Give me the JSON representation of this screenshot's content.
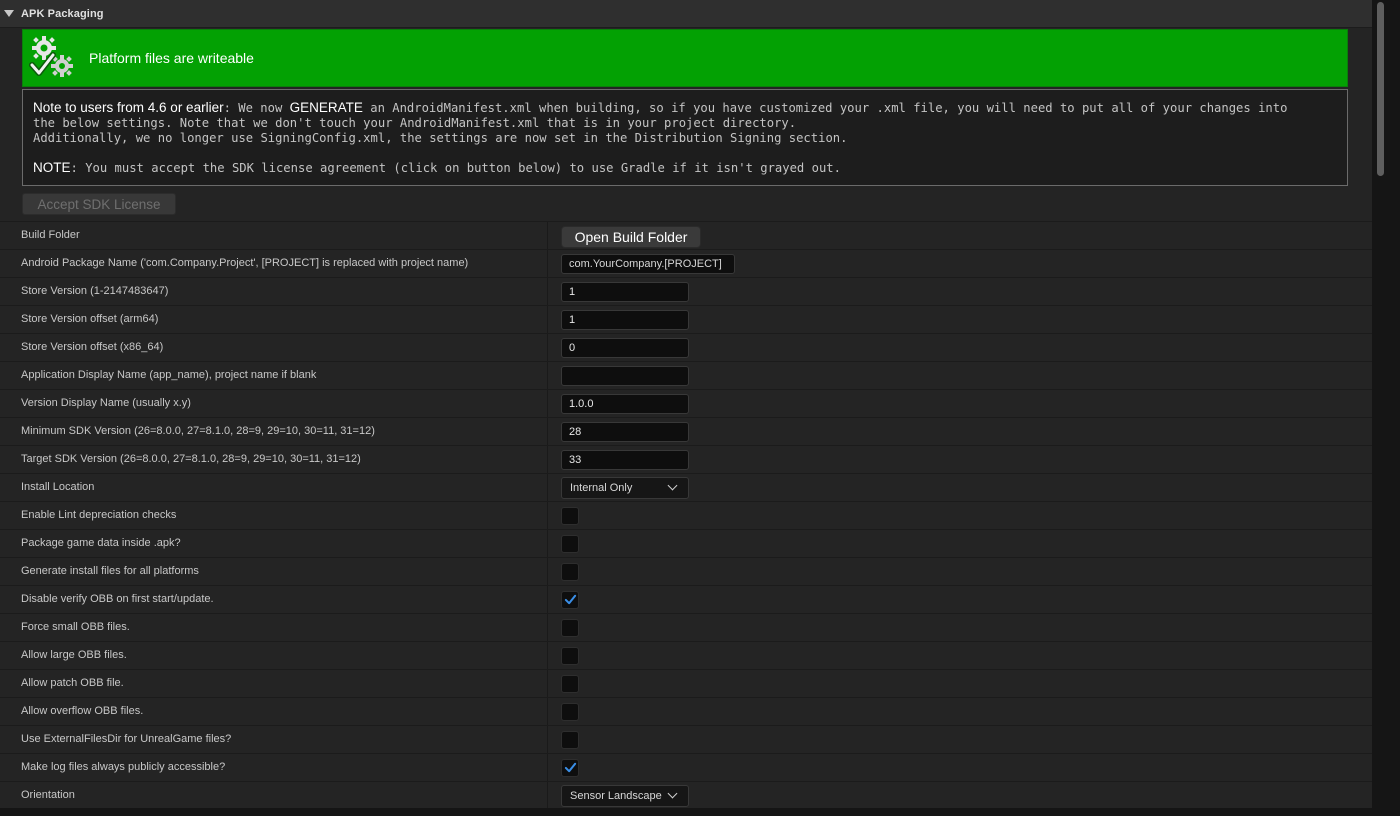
{
  "section": {
    "title": "APK Packaging"
  },
  "banner": {
    "text": "Platform files are writeable",
    "icon": "gears-check-icon",
    "color": "#03a103"
  },
  "note": {
    "line1_lead": "Note to users from 4.6 or earlier",
    "line1_mid": ": We now ",
    "line1_strong": "GENERATE",
    "line1_rest": " an AndroidManifest.xml when building, so if you have customized your .xml file, you will need to put all of your changes into",
    "line2": "the below settings. Note that we don't touch your AndroidManifest.xml that is in your project directory.",
    "line3": "Additionally, we no longer use SigningConfig.xml, the settings are now set in the Distribution Signing section.",
    "line4_lead": "NOTE",
    "line4_rest": ": You must accept the SDK license agreement (click on button below) to use Gradle if it isn't grayed out."
  },
  "accept_button": {
    "label": "Accept SDK License",
    "disabled": true
  },
  "rows": {
    "build_folder": {
      "label": "Build Folder",
      "button": "Open Build Folder"
    },
    "package_name": {
      "label": "Android Package Name ('com.Company.Project', [PROJECT] is replaced with project name)",
      "value": "com.YourCompany.[PROJECT]"
    },
    "store_version": {
      "label": "Store Version (1-2147483647)",
      "value": "1"
    },
    "store_offset_arm64": {
      "label": "Store Version offset (arm64)",
      "value": "1"
    },
    "store_offset_x86": {
      "label": "Store Version offset (x86_64)",
      "value": "0"
    },
    "app_display_name": {
      "label": "Application Display Name (app_name), project name if blank",
      "value": ""
    },
    "version_display": {
      "label": "Version Display Name (usually x.y)",
      "value": "1.0.0"
    },
    "min_sdk": {
      "label": "Minimum SDK Version (26=8.0.0, 27=8.1.0, 28=9, 29=10, 30=11, 31=12)",
      "value": "28"
    },
    "target_sdk": {
      "label": "Target SDK Version (26=8.0.0, 27=8.1.0, 28=9, 29=10, 30=11, 31=12)",
      "value": "33"
    },
    "install_location": {
      "label": "Install Location",
      "value": "Internal Only"
    },
    "lint_checks": {
      "label": "Enable Lint depreciation checks",
      "checked": false
    },
    "package_in_apk": {
      "label": "Package game data inside .apk?",
      "checked": false
    },
    "install_files": {
      "label": "Generate install files for all platforms",
      "checked": false
    },
    "disable_verify_obb": {
      "label": "Disable verify OBB on first start/update.",
      "checked": true
    },
    "force_small_obb": {
      "label": "Force small OBB files.",
      "checked": false
    },
    "allow_large_obb": {
      "label": "Allow large OBB files.",
      "checked": false
    },
    "allow_patch_obb": {
      "label": "Allow patch OBB file.",
      "checked": false
    },
    "allow_overflow_obb": {
      "label": "Allow overflow OBB files.",
      "checked": false
    },
    "external_files_dir": {
      "label": "Use ExternalFilesDir for UnrealGame files?",
      "checked": false
    },
    "log_files_public": {
      "label": "Make log files always publicly accessible?",
      "checked": true
    },
    "orientation": {
      "label": "Orientation",
      "value": "Sensor Landscape"
    }
  },
  "colors": {
    "accent": "#03a103",
    "checkmark": "#3a8ee6",
    "panel": "#242424"
  }
}
